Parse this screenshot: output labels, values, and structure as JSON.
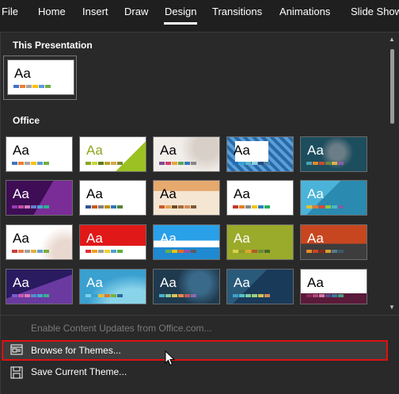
{
  "tabs": [
    "File",
    "Home",
    "Insert",
    "Draw",
    "Design",
    "Transitions",
    "Animations",
    "Slide Show"
  ],
  "active_tab": "Design",
  "sections": {
    "this_presentation": "This Presentation",
    "office": "Office"
  },
  "menu": {
    "enable_updates": "Enable Content Updates from Office.com...",
    "browse_themes": "Browse for Themes...",
    "save_theme": "Save Current Theme..."
  },
  "aa": "Aa",
  "colors": {
    "highlight_border": "#e01010",
    "panel_bg": "#292929",
    "ribbon_bg": "#1f1f1f"
  }
}
